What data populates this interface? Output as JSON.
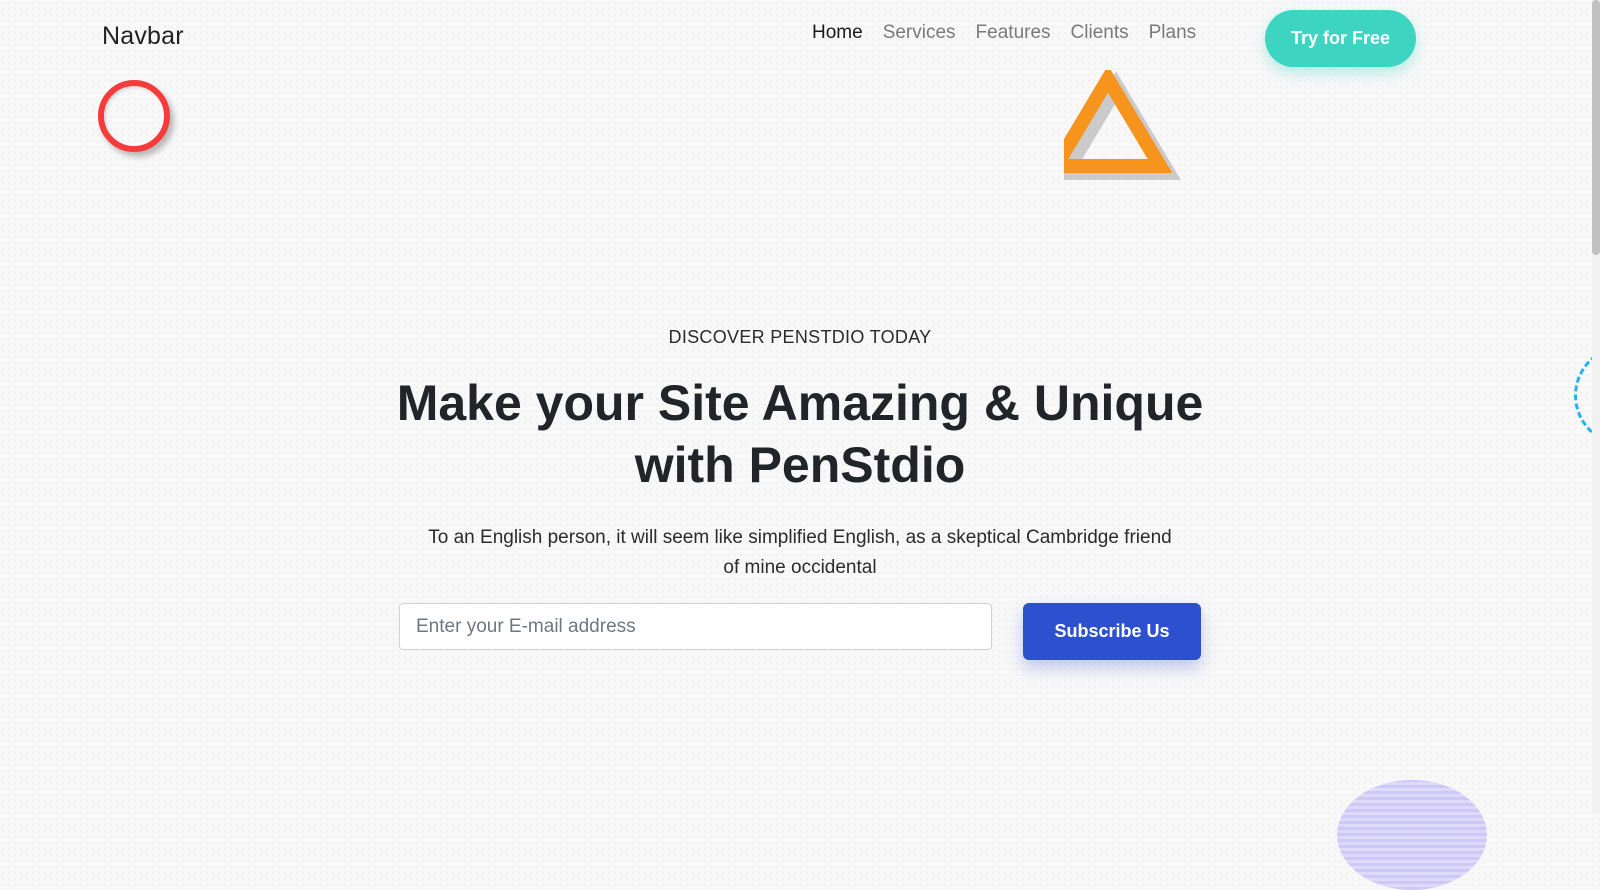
{
  "navbar": {
    "brand": "Navbar",
    "links": [
      {
        "label": "Home",
        "active": true
      },
      {
        "label": "Services",
        "active": false
      },
      {
        "label": "Features",
        "active": false
      },
      {
        "label": "Clients",
        "active": false
      },
      {
        "label": "Plans",
        "active": false
      }
    ],
    "cta_label": "Try for Free"
  },
  "hero": {
    "eyebrow": "DISCOVER PENSTDIO TODAY",
    "headline_line1": "Make your Site Amazing & Unique",
    "headline_line2": "with PenStdio",
    "subtext_line1": "To an English person, it will seem like simplified English, as a skeptical Cambridge friend",
    "subtext_line2": "of mine occidental",
    "email_placeholder": "Enter your E-mail address",
    "subscribe_label": "Subscribe Us"
  },
  "icons": {
    "ring": "circle-outline-shape",
    "triangle": "triangle-outline-shape",
    "dashed": "dashed-circle-shape",
    "blob": "striped-circle-shape"
  },
  "colors": {
    "cta_teal": "#3dd4c1",
    "subscribe_blue": "#2c50d0",
    "ring_red": "#f53b3b",
    "triangle_orange": "#f7941d",
    "dashed_blue": "#26b3ea",
    "blob_purple": "#c9c2f7"
  }
}
